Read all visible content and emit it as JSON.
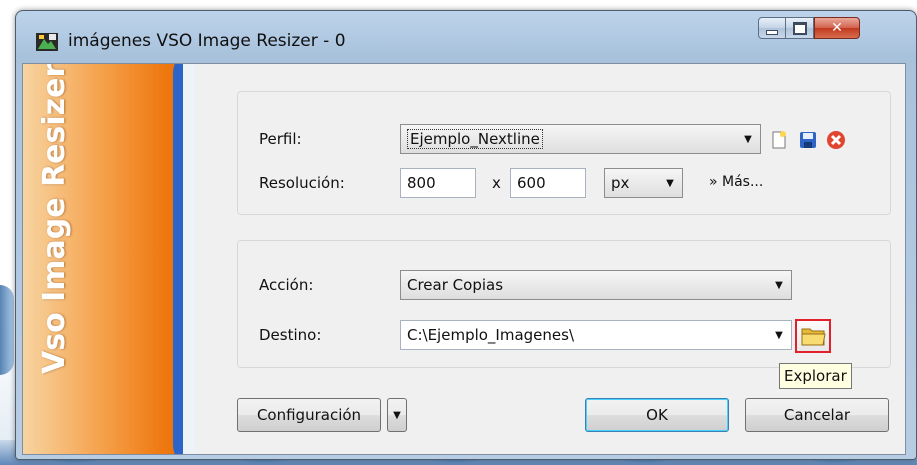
{
  "window": {
    "title": "imágenes VSO Image Resizer - 0"
  },
  "banner": {
    "brand": "Image Resizer",
    "logo_text": "Vso"
  },
  "profile": {
    "label": "Perfil:",
    "value": "Ejemplo_Nextline"
  },
  "resolution": {
    "label": "Resolución:",
    "width": "800",
    "separator": "x",
    "height": "600",
    "unit": "px",
    "more_link": "» Más..."
  },
  "action": {
    "label": "Acción:",
    "value": "Crear Copias"
  },
  "destination": {
    "label": "Destino:",
    "value": "C:\\Ejemplo_Imagenes\\",
    "browse_tooltip": "Explorar"
  },
  "buttons": {
    "settings": "Configuración",
    "ok": "OK",
    "cancel": "Cancelar"
  },
  "colors": {
    "banner_orange": "#ef7a12",
    "banner_blue": "#2c64c8",
    "highlight_red": "#e0202a"
  }
}
